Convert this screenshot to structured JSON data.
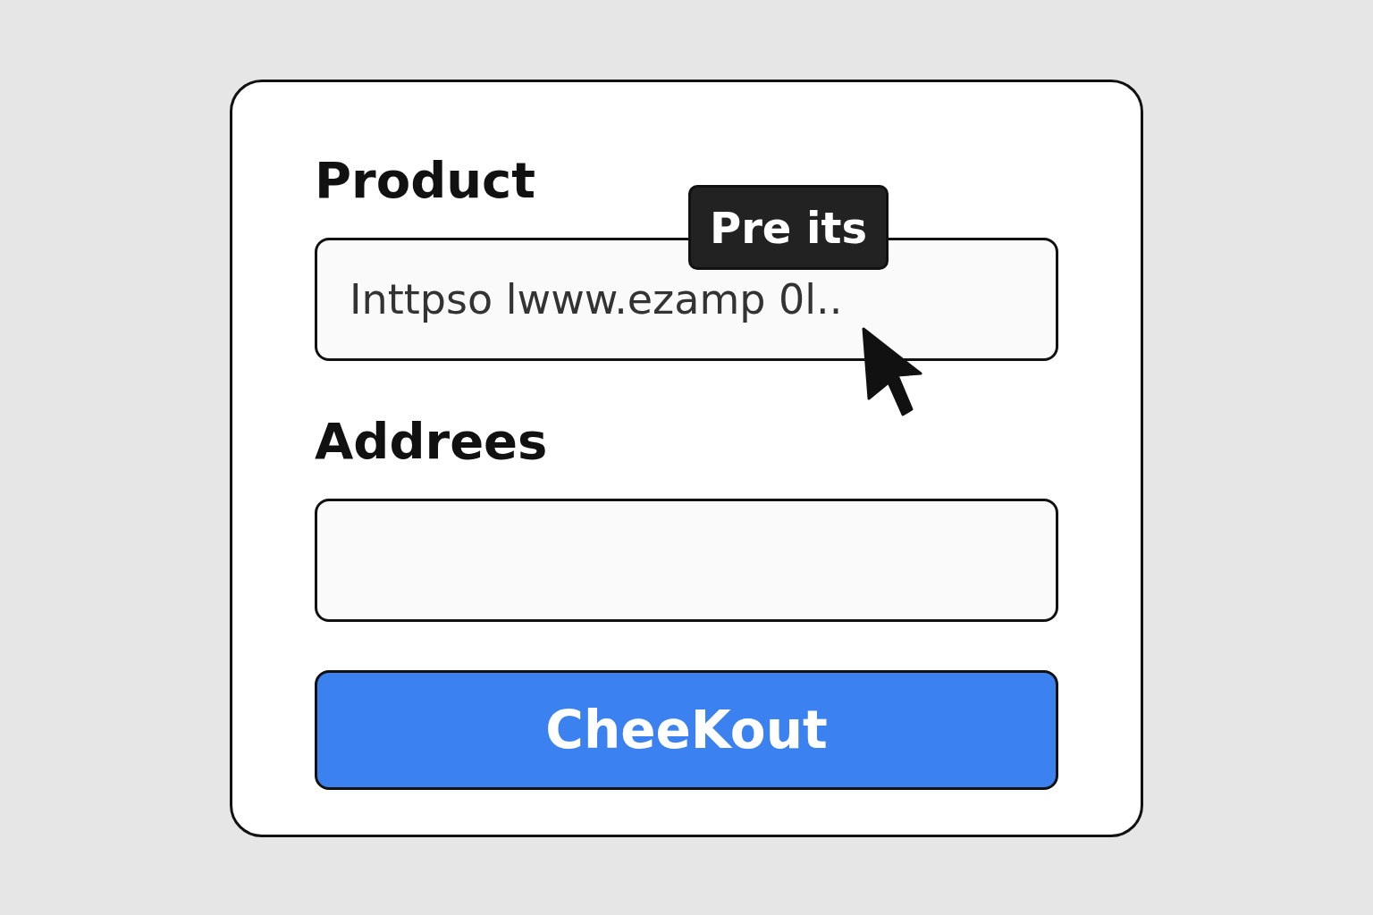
{
  "form": {
    "fields": [
      {
        "label": "Product",
        "value": "Inttpso lwww.ezamp 0l..",
        "tooltip": "Pre its"
      },
      {
        "label": "Addrees"
      }
    ],
    "button": "CheeKout"
  }
}
